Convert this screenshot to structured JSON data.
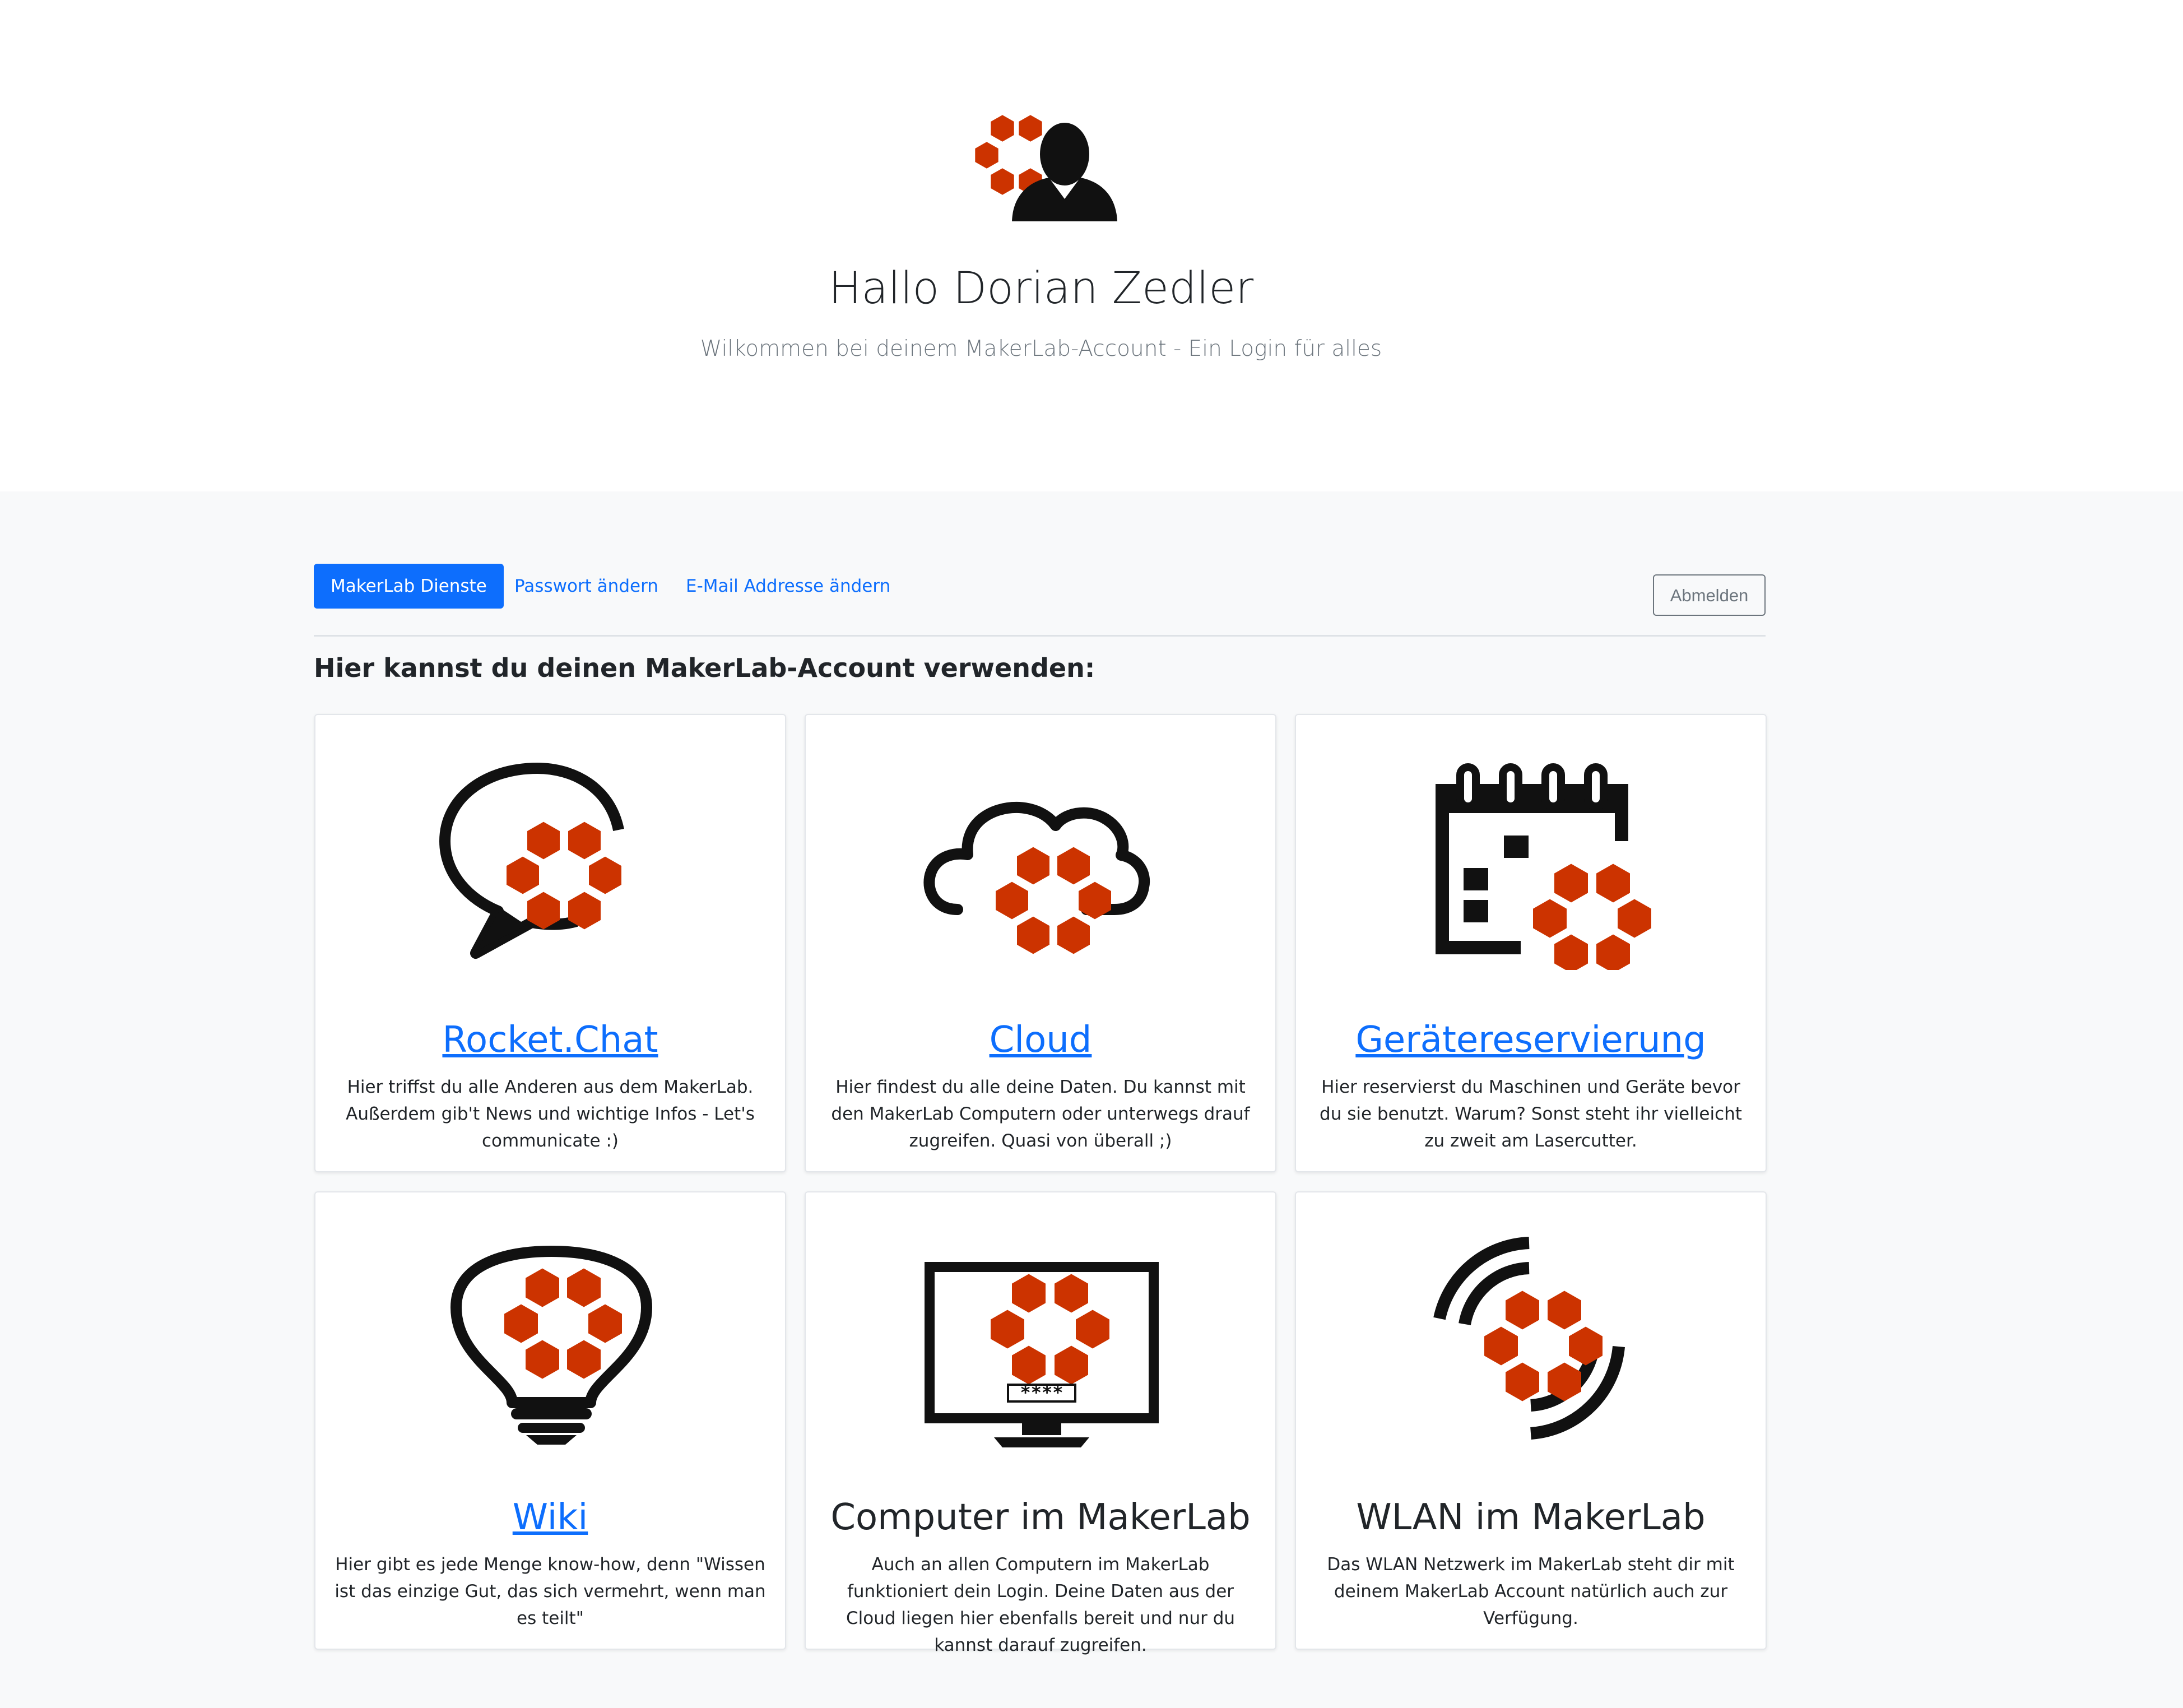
{
  "header": {
    "greeting": "Hallo Dorian Zedler",
    "subtitle": "Wilkommen bei deinem MakerLab-Account - Ein Login für alles",
    "logo_icon": "makerlab-user-icon"
  },
  "nav": {
    "tabs": [
      {
        "label": "MakerLab Dienste",
        "active": true
      },
      {
        "label": "Passwort ändern",
        "active": false
      },
      {
        "label": "E-Mail Addresse ändern",
        "active": false
      }
    ],
    "logout_label": "Abmelden"
  },
  "section_heading": "Hier kannst du deinen MakerLab-Account verwenden:",
  "services": [
    {
      "title": "Rocket.Chat",
      "is_link": true,
      "icon": "chat-bubble-icon",
      "description": "Hier triffst du alle Anderen aus dem MakerLab. Außerdem gib't News und wichtige Infos - Let's communicate :)"
    },
    {
      "title": "Cloud",
      "is_link": true,
      "icon": "cloud-icon",
      "description": "Hier findest du alle deine Daten. Du kannst mit den MakerLab Computern oder unterwegs drauf zugreifen. Quasi von überall ;)"
    },
    {
      "title": "Gerätereservierung",
      "is_link": true,
      "icon": "calendar-icon",
      "description": "Hier reservierst du Maschinen und Geräte bevor du sie benutzt. Warum? Sonst steht ihr vielleicht zu zweit am Lasercutter."
    },
    {
      "title": "Wiki",
      "is_link": true,
      "icon": "lightbulb-icon",
      "description": "Hier gibt es jede Menge know-how, denn \"Wissen ist das einzige Gut, das sich vermehrt, wenn man es teilt\""
    },
    {
      "title": "Computer im MakerLab",
      "is_link": false,
      "icon": "computer-monitor-icon",
      "screen_text": "****",
      "description": "Auch an allen Computern im MakerLab funktioniert dein Login. Deine Daten aus der Cloud liegen hier ebenfalls bereit und nur du kannst darauf zugreifen."
    },
    {
      "title": "WLAN im MakerLab",
      "is_link": false,
      "icon": "wifi-icon",
      "description": "Das WLAN Netzwerk im MakerLab steht dir mit deinem MakerLab Account natürlich auch zur Verfügung."
    }
  ],
  "colors": {
    "accent": "#0d6efd",
    "hexagon": "#cc3300",
    "icon": "#111111",
    "muted": "#6c757d"
  }
}
